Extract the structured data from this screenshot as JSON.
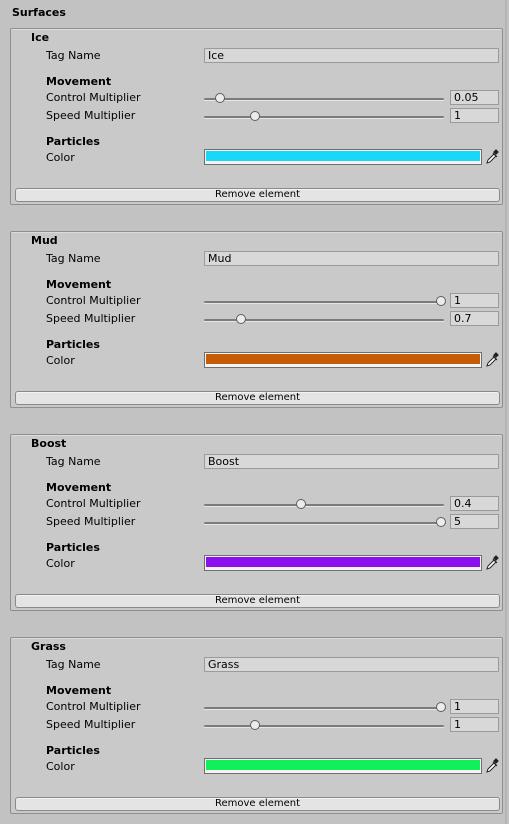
{
  "header": {
    "title": "Surfaces"
  },
  "labels": {
    "tag_name": "Tag Name",
    "movement": "Movement",
    "control_multiplier": "Control Multiplier",
    "speed_multiplier": "Speed Multiplier",
    "particles": "Particles",
    "color": "Color",
    "remove": "Remove element"
  },
  "surfaces": [
    {
      "name": "Ice",
      "tag_name": "Ice",
      "control_multiplier": "0.05",
      "control_level": 0.05,
      "speed_multiplier": "1",
      "speed_level": 0.2,
      "color": "#1ad6f7"
    },
    {
      "name": "Mud",
      "tag_name": "Mud",
      "control_multiplier": "1",
      "control_level": 1.0,
      "speed_multiplier": "0.7",
      "speed_level": 0.14,
      "color": "#c45c0a"
    },
    {
      "name": "Boost",
      "tag_name": "Boost",
      "control_multiplier": "0.4",
      "control_level": 0.4,
      "speed_multiplier": "5",
      "speed_level": 1.0,
      "color": "#8b10f0"
    },
    {
      "name": "Grass",
      "tag_name": "Grass",
      "control_multiplier": "1",
      "control_level": 1.0,
      "speed_multiplier": "1",
      "speed_level": 0.2,
      "color": "#10f05a"
    }
  ],
  "icons": {
    "picker": "eyedropper-icon"
  }
}
